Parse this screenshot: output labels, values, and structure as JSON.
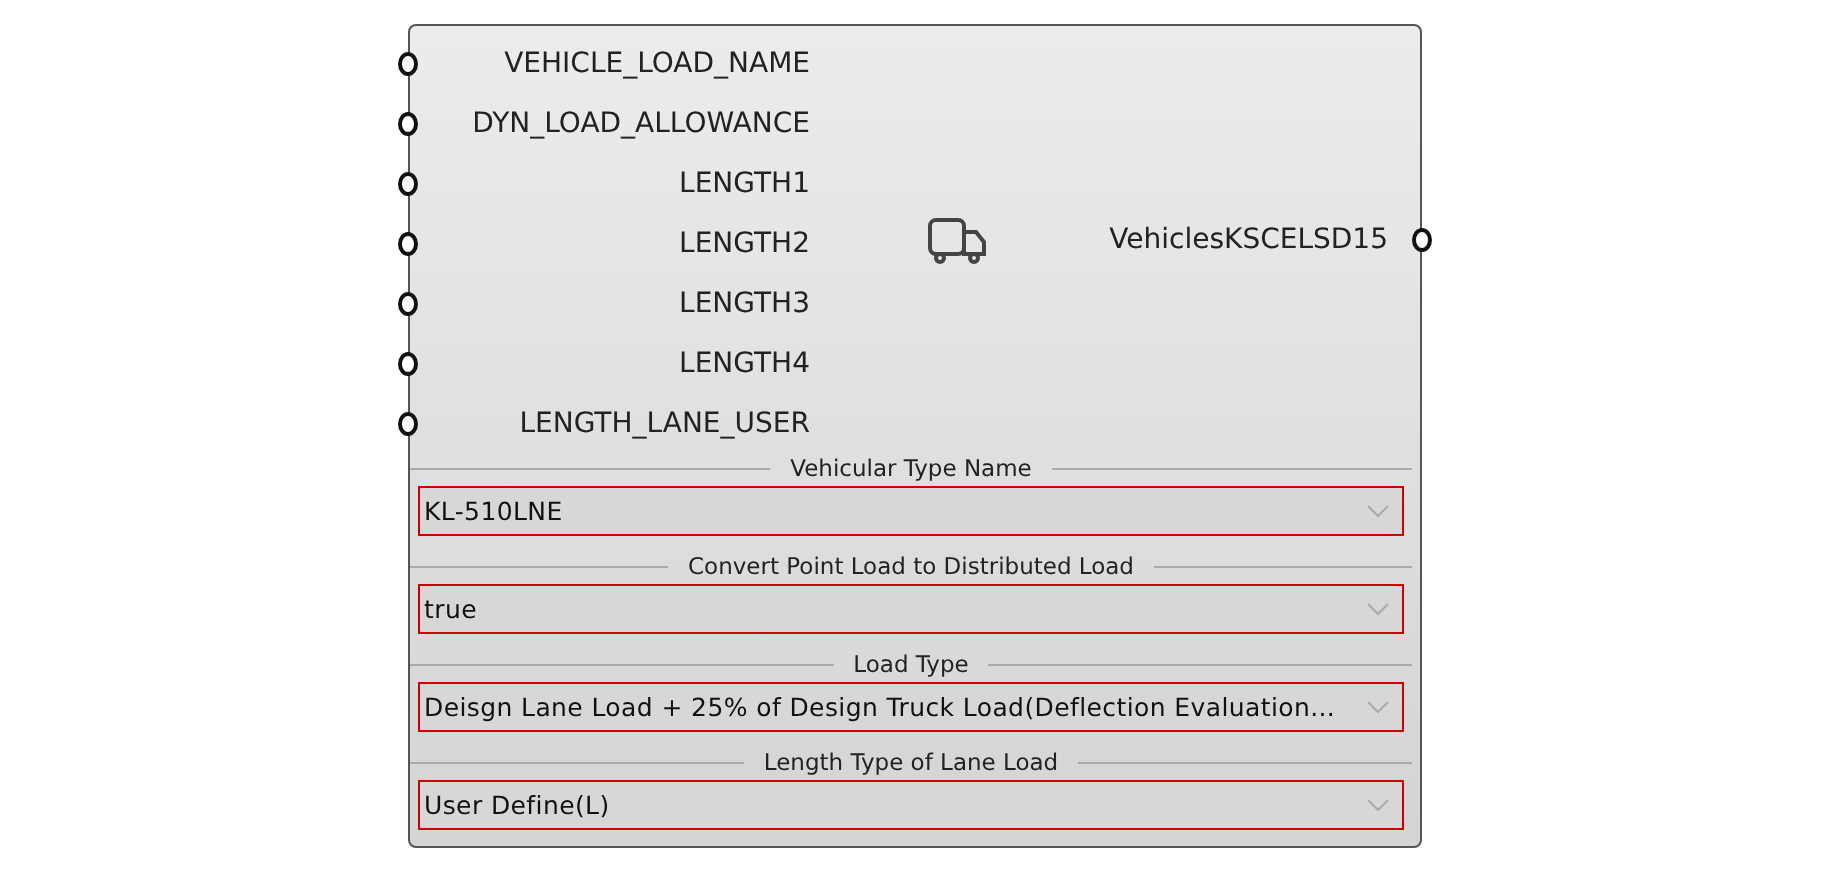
{
  "component": {
    "inputs": [
      {
        "name": "VEHICLE_LOAD_NAME"
      },
      {
        "name": "DYN_LOAD_ALLOWANCE"
      },
      {
        "name": "LENGTH1"
      },
      {
        "name": "LENGTH2"
      },
      {
        "name": "LENGTH3"
      },
      {
        "name": "LENGTH4"
      },
      {
        "name": "LENGTH_LANE_USER"
      }
    ],
    "outputs": [
      {
        "name": "VehiclesKSCELSD15"
      }
    ],
    "dropdowns": [
      {
        "label": "Vehicular Type Name",
        "value": "KL-510LNE"
      },
      {
        "label": "Convert Point Load to Distributed Load",
        "value": "true"
      },
      {
        "label": "Load Type",
        "value": "Deisgn Lane Load + 25% of Design Truck Load(Deflection Evaluation..."
      },
      {
        "label": "Length Type of Lane Load",
        "value": "User Define(L)"
      }
    ]
  }
}
